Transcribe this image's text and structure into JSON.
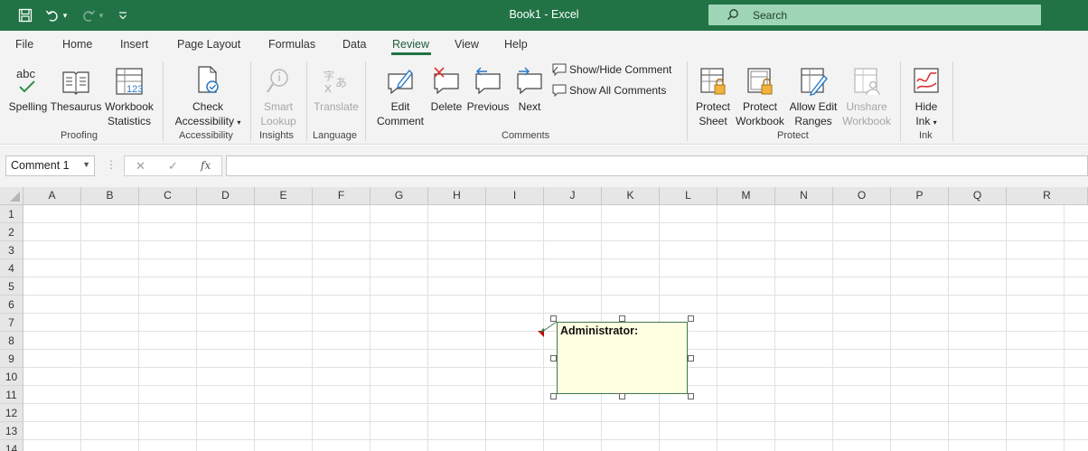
{
  "window": {
    "title": "Book1  -  Excel",
    "search_placeholder": "Search"
  },
  "menu": {
    "tabs": [
      "File",
      "Home",
      "Insert",
      "Page Layout",
      "Formulas",
      "Data",
      "Review",
      "View",
      "Help"
    ],
    "active": "Review"
  },
  "ribbon": {
    "proofing": {
      "label": "Proofing",
      "spelling": "Spelling",
      "thesaurus": "Thesaurus",
      "workbook_statistics_1": "Workbook",
      "workbook_statistics_2": "Statistics"
    },
    "accessibility": {
      "label": "Accessibility",
      "check_1": "Check",
      "check_2": "Accessibility"
    },
    "insights": {
      "label": "Insights",
      "smart_1": "Smart",
      "smart_2": "Lookup"
    },
    "language": {
      "label": "Language",
      "translate": "Translate"
    },
    "comments": {
      "label": "Comments",
      "edit_1": "Edit",
      "edit_2": "Comment",
      "delete": "Delete",
      "previous": "Previous",
      "next": "Next",
      "show_hide": "Show/Hide Comment",
      "show_all": "Show All Comments"
    },
    "protect": {
      "label": "Protect",
      "sheet_1": "Protect",
      "sheet_2": "Sheet",
      "workbook_1": "Protect",
      "workbook_2": "Workbook",
      "allow_1": "Allow Edit",
      "allow_2": "Ranges",
      "unshare_1": "Unshare",
      "unshare_2": "Workbook"
    },
    "ink": {
      "label": "Ink",
      "hide_1": "Hide",
      "hide_2": "Ink"
    }
  },
  "formula_bar": {
    "name_box": "Comment 1",
    "fx": "fx",
    "value": ""
  },
  "sheet": {
    "columns": [
      "A",
      "B",
      "C",
      "D",
      "E",
      "F",
      "G",
      "H",
      "I",
      "J",
      "K",
      "L",
      "M",
      "N",
      "O",
      "P",
      "Q",
      "R"
    ],
    "rows": [
      "1",
      "2",
      "3",
      "4",
      "5",
      "6",
      "7",
      "8",
      "9",
      "10",
      "11",
      "12",
      "13",
      "14"
    ]
  },
  "comment": {
    "author": "Administrator:",
    "text": ""
  },
  "colors": {
    "accent": "#217346",
    "comment_fill": "#ffffe1",
    "comment_indicator": "#c00000"
  }
}
